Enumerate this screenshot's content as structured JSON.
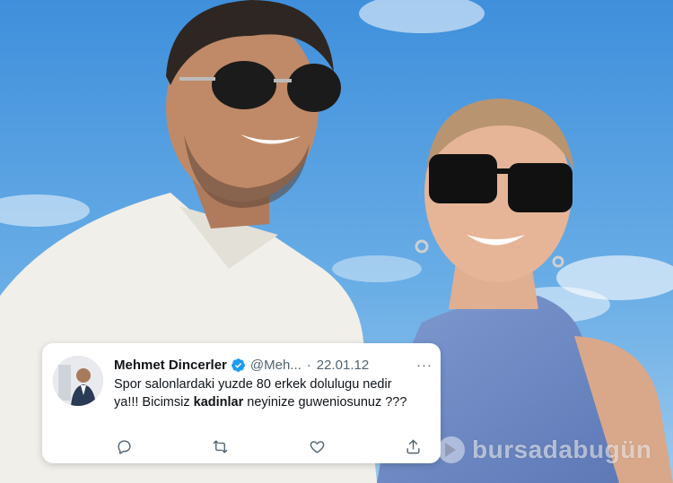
{
  "tweet": {
    "author_name": "Mehmet Dincerler",
    "handle": "@Meh...",
    "separator": "·",
    "date": "22.01.12",
    "more": "···",
    "text_part1": "Spor salonlardaki yuzde 80 erkek dolulugu nedir ya!!! Bicimsiz ",
    "text_bold": "kadinlar",
    "text_part2": " neyinize guweniosunuz ???",
    "actions": [
      "reply-icon",
      "retweet-icon",
      "like-icon",
      "share-icon"
    ]
  },
  "watermark": {
    "text": "bursadabugün"
  },
  "colors": {
    "sky": "#5a9fe0",
    "verified": "#1d9bf0",
    "text": "#0f1419",
    "muted": "#536471"
  }
}
